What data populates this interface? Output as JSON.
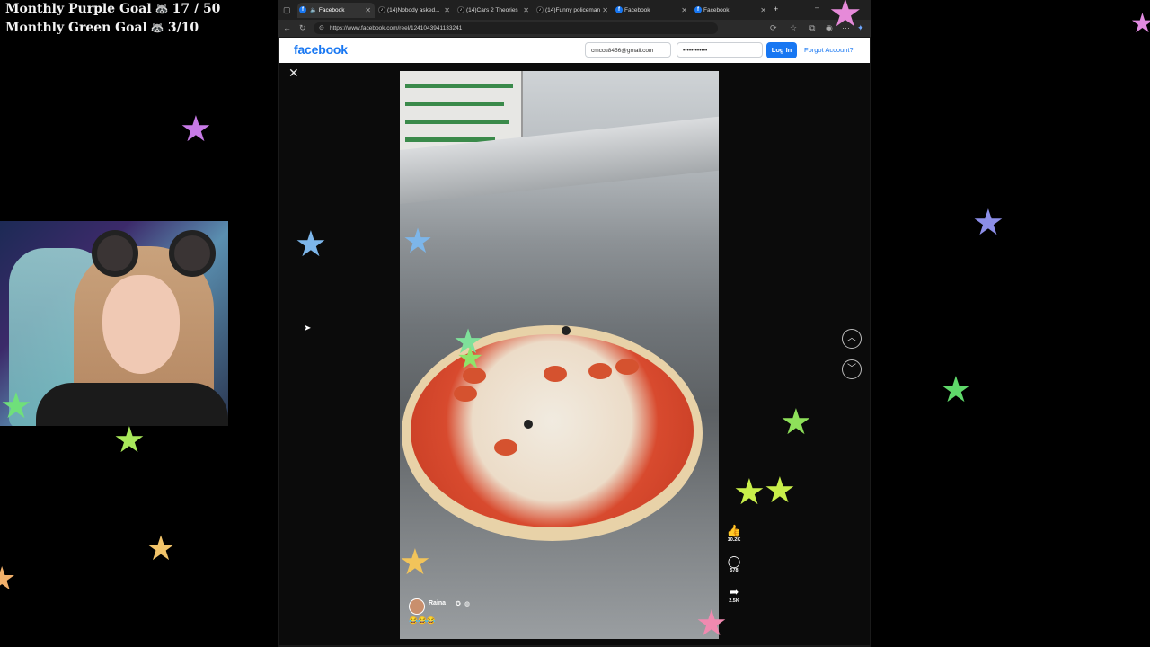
{
  "overlay": {
    "goals": [
      {
        "label": "Monthly Purple Goal",
        "icon": "raccoon-icon",
        "value": "17 / 50"
      },
      {
        "label": "Monthly Green Goal",
        "icon": "raccoon-icon",
        "value": "3/10"
      }
    ]
  },
  "browser": {
    "tabs": [
      {
        "title": "Facebook",
        "icon": "facebook-icon",
        "active": true
      },
      {
        "title": "(14)Nobody asked...",
        "icon": "tiktok-icon",
        "active": false
      },
      {
        "title": "(14)Cars 2 Theories",
        "icon": "tiktok-icon",
        "active": false
      },
      {
        "title": "(14)Funny policeman",
        "icon": "tiktok-icon",
        "active": false
      },
      {
        "title": "Facebook",
        "icon": "facebook-icon",
        "active": false
      },
      {
        "title": "Facebook",
        "icon": "facebook-icon",
        "active": false
      }
    ],
    "url": "https://www.facebook.com/reel/1241043941133241"
  },
  "facebook": {
    "logo": "facebook",
    "email_value": "cmccu8456@gmail.com",
    "password_value": "••••••••••••",
    "login_label": "Log In",
    "forgot_label": "Forgot Account?"
  },
  "reel": {
    "likes": "10.2K",
    "comments": "578",
    "shares": "2.5K",
    "author": "Raina",
    "emojis": "😂😂😂"
  },
  "colors": {
    "facebook_blue": "#1877f2",
    "background": "#000000"
  }
}
